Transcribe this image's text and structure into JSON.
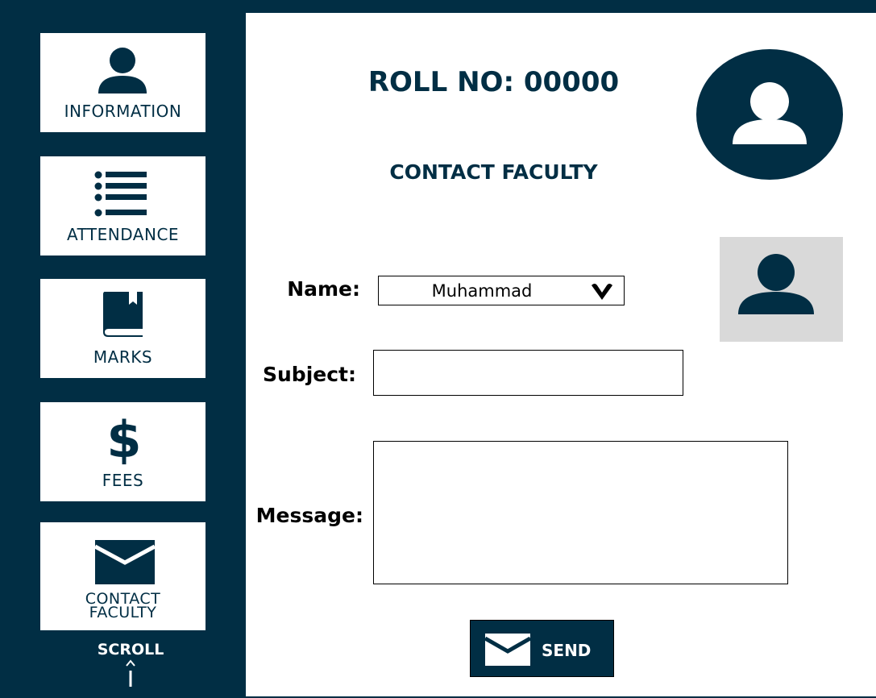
{
  "sidebar": {
    "items": [
      {
        "label": "INFORMATION",
        "icon": "user-icon"
      },
      {
        "label": "ATTENDANCE",
        "icon": "list-icon"
      },
      {
        "label": "MARKS",
        "icon": "book-icon"
      },
      {
        "label": "FEES",
        "icon": "dollar-icon"
      },
      {
        "label_line1": "CONTACT",
        "label_line2": "FACULTY",
        "icon": "envelope-icon"
      }
    ],
    "scroll_label": "SCROLL",
    "scroll_icon": "up-arrow-icon"
  },
  "header": {
    "title": "ROLL NO: 00000",
    "subtitle": "CONTACT FACULTY"
  },
  "form": {
    "name_label": "Name:",
    "name_value": "Muhammad",
    "subject_label": "Subject:",
    "subject_value": "",
    "message_label": "Message:",
    "message_value": "",
    "send_label": "SEND"
  },
  "colors": {
    "primary": "#012e44",
    "background": "#ffffff",
    "placeholder_bg": "#d9d9d9"
  }
}
